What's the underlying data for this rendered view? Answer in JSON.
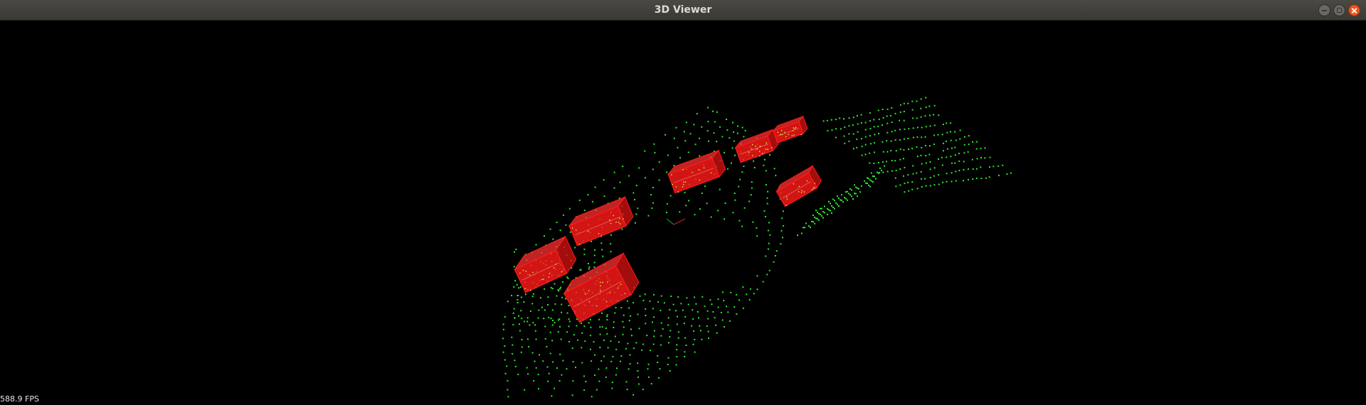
{
  "window": {
    "title": "3D Viewer",
    "controls": [
      "minimize",
      "maximize",
      "close"
    ]
  },
  "viewport": {
    "background_color": "#000000",
    "point_color": "#2eea2e",
    "box_color": "#ff1a1a",
    "box_count": 7,
    "fps_label": "588.9 FPS"
  },
  "icons": {
    "minimize": "minimize-icon",
    "maximize": "maximize-icon",
    "close": "close-icon"
  }
}
